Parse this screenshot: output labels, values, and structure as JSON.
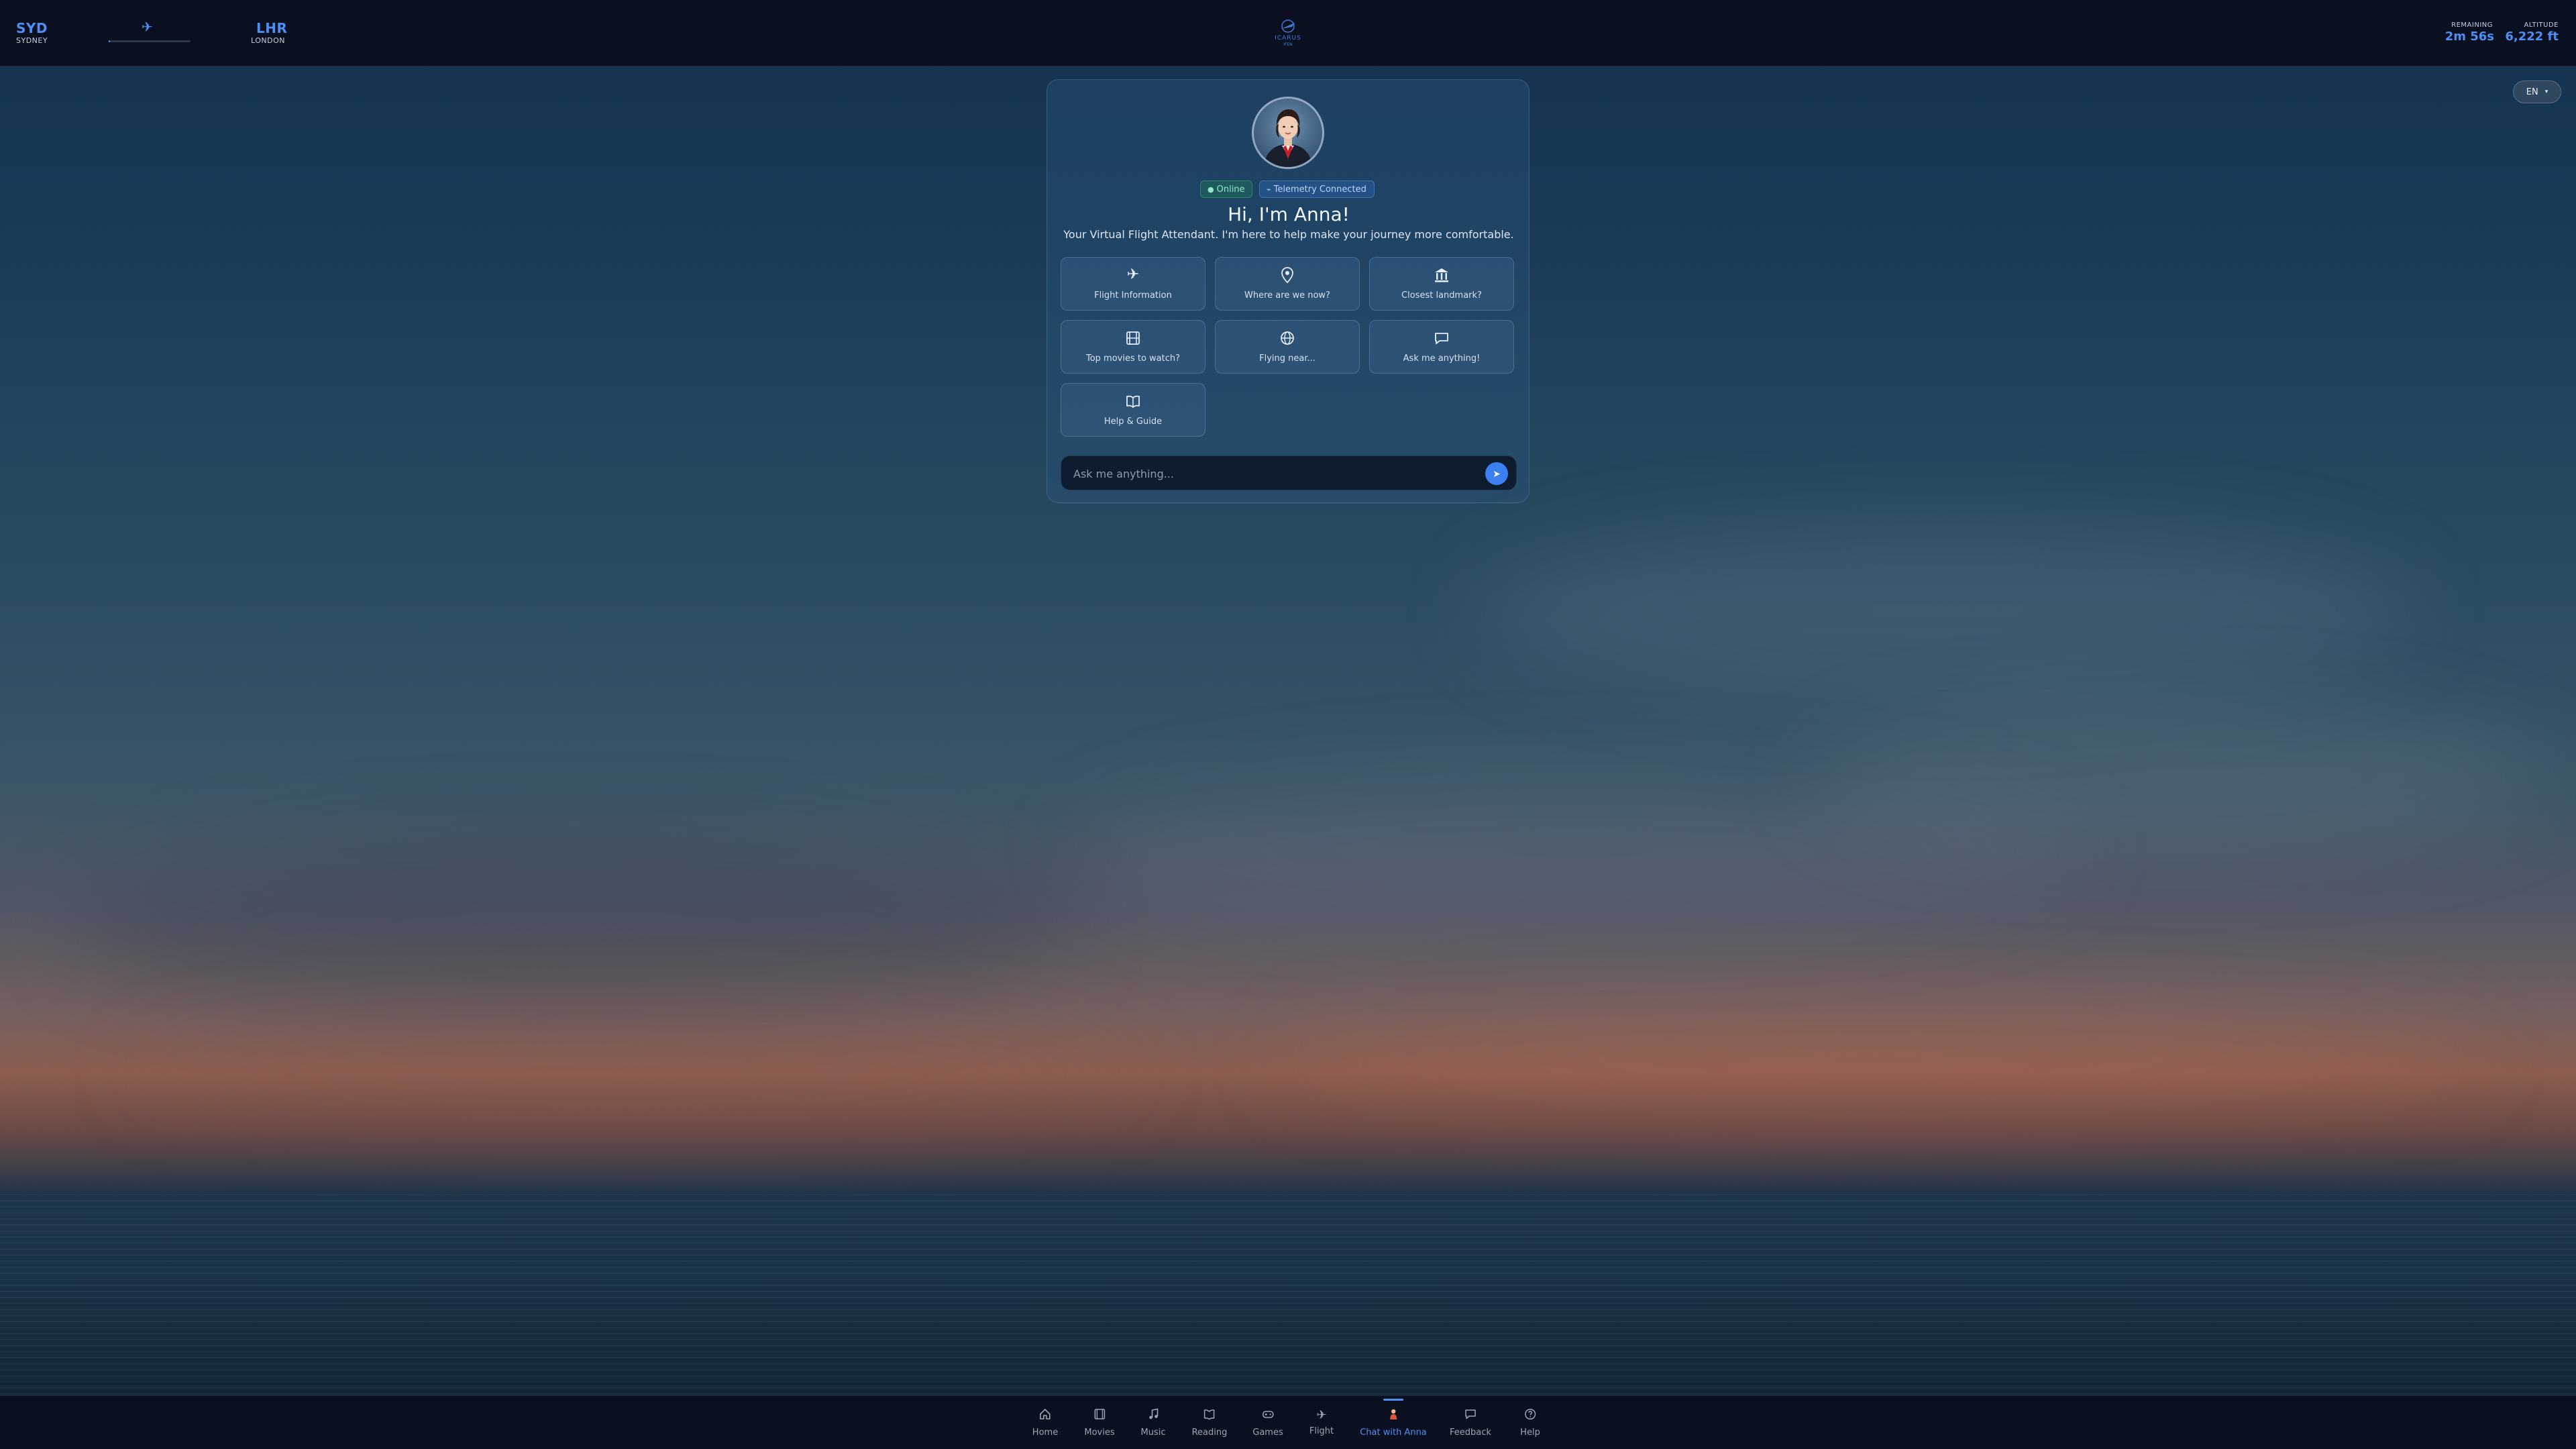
{
  "topbar": {
    "origin": {
      "code": "SYD",
      "city": "SYDNEY"
    },
    "destination": {
      "code": "LHR",
      "city": "LONDON"
    },
    "flight_progress": 0.02,
    "logo": {
      "name": "ICARUS",
      "sub": "IFEN"
    },
    "remaining": {
      "label": "REMAINING",
      "value": "2m 56s"
    },
    "altitude": {
      "label": "ALTITUDE",
      "value": "6,222 ft"
    }
  },
  "language": {
    "selected": "EN"
  },
  "chat": {
    "status_online": "Online",
    "status_telemetry": "Telemetry Connected",
    "greeting": "Hi, I'm Anna!",
    "subtitle": "Your Virtual Flight Attendant. I'm here to help make your journey more comfortable.",
    "quick_actions": [
      {
        "label": "Flight Information",
        "icon": "airplane-icon"
      },
      {
        "label": "Where are we now?",
        "icon": "map-pin-icon"
      },
      {
        "label": "Closest landmark?",
        "icon": "landmark-icon"
      },
      {
        "label": "Top movies to watch?",
        "icon": "film-icon"
      },
      {
        "label": "Flying near...",
        "icon": "globe-icon"
      },
      {
        "label": "Ask me anything!",
        "icon": "chat-bubble-icon"
      },
      {
        "label": "Help & Guide",
        "icon": "book-icon"
      }
    ],
    "input_placeholder": "Ask me anything..."
  },
  "bottom_nav": {
    "items": [
      {
        "label": "Home",
        "icon": "home-icon"
      },
      {
        "label": "Movies",
        "icon": "movies-icon"
      },
      {
        "label": "Music",
        "icon": "music-icon"
      },
      {
        "label": "Reading",
        "icon": "reading-icon"
      },
      {
        "label": "Games",
        "icon": "games-icon"
      },
      {
        "label": "Flight",
        "icon": "airplane-icon"
      },
      {
        "label": "Chat with Anna",
        "icon": "anna-icon"
      },
      {
        "label": "Feedback",
        "icon": "feedback-icon"
      },
      {
        "label": "Help",
        "icon": "help-icon"
      }
    ],
    "active": "Chat with Anna"
  },
  "colors": {
    "accent": "#4d8ff5",
    "bar_background": "#0a1020",
    "online_green": "#8fe6c4"
  }
}
